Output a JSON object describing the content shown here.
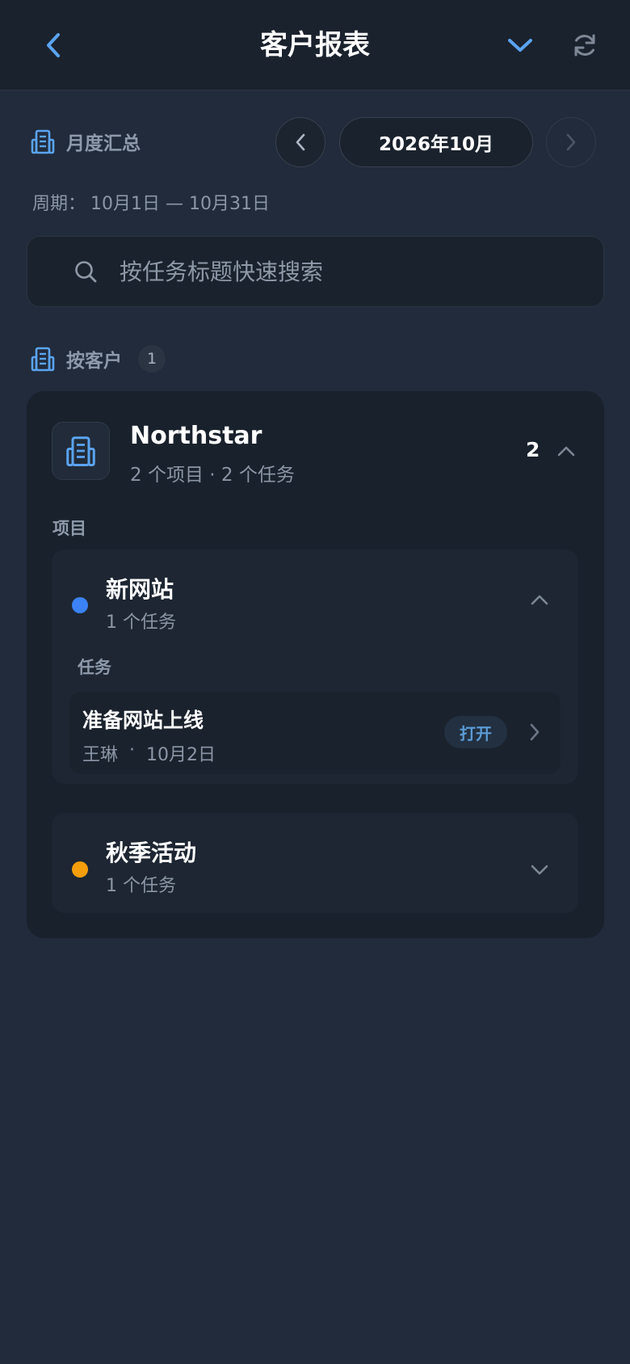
{
  "header": {
    "title": "客户报表",
    "back_icon": "chevron-left-icon",
    "dropdown_icon": "chevron-down-icon",
    "refresh_icon": "refresh-icon"
  },
  "summary": {
    "label": "月度汇总",
    "month": "2026年10月",
    "period_prefix": "周期：",
    "period_range": "10月1日 — 10月31日"
  },
  "search": {
    "placeholder": "按任务标题快速搜索",
    "value": ""
  },
  "clients_section": {
    "label": "按客户",
    "count": "1"
  },
  "client": {
    "name": "Northstar",
    "subtitle": "2 个项目 · 2 个任务",
    "count": "2",
    "projects_label": "项目",
    "projects": [
      {
        "name": "新网站",
        "subtitle": "1 个任务",
        "color": "#3b82f6",
        "expanded": true,
        "tasks_label": "任务",
        "tasks": [
          {
            "title": "准备网站上线",
            "assignee": "王琳",
            "separator": "·",
            "date": "10月2日",
            "status": "打开"
          }
        ]
      },
      {
        "name": "秋季活动",
        "subtitle": "1 个任务",
        "color": "#f59e0b",
        "expanded": false
      }
    ]
  },
  "colors": {
    "accent": "#5ba4f0",
    "background": "#212b3b",
    "card": "#19212c"
  }
}
